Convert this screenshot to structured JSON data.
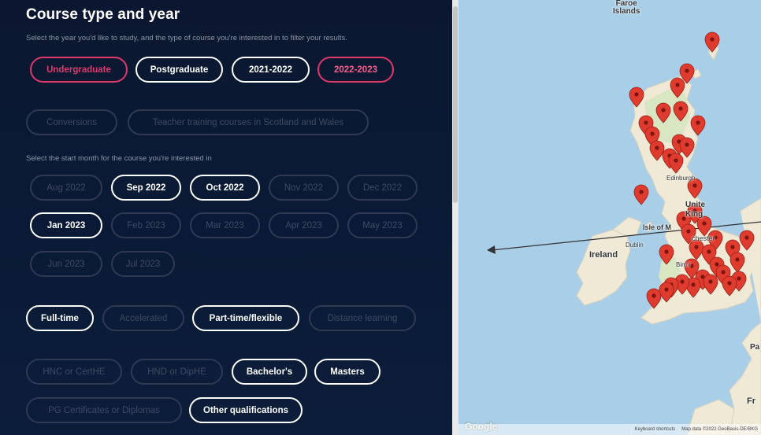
{
  "panel": {
    "title": "Course type and year",
    "subtitle_year": "Select the year you'd like to study, and the type of course you're interested in to filter your results.",
    "subtitle_month": "Select the start month for the course you're interested in",
    "course_type": [
      {
        "label": "Undergraduate",
        "state": "pink"
      },
      {
        "label": "Postgraduate",
        "state": "on"
      }
    ],
    "years": [
      {
        "label": "2021-2022",
        "state": "on"
      },
      {
        "label": "2022-2023",
        "state": "pink"
      }
    ],
    "extra_types": [
      {
        "label": "Conversions",
        "state": "dim"
      },
      {
        "label": "Teacher training courses in Scotland and Wales",
        "state": "dim"
      }
    ],
    "months_row1": [
      {
        "label": "Aug 2022",
        "state": "dim"
      },
      {
        "label": "Sep 2022",
        "state": "on"
      },
      {
        "label": "Oct 2022",
        "state": "on"
      },
      {
        "label": "Nov 2022",
        "state": "dim"
      },
      {
        "label": "Dec 2022",
        "state": "dim"
      }
    ],
    "months_row2": [
      {
        "label": "Jan 2023",
        "state": "on"
      },
      {
        "label": "Feb 2023",
        "state": "dim"
      },
      {
        "label": "Mar 2023",
        "state": "dim"
      },
      {
        "label": "Apr 2023",
        "state": "dim"
      },
      {
        "label": "May 2023",
        "state": "dim"
      }
    ],
    "months_row3": [
      {
        "label": "Jun 2023",
        "state": "dim"
      },
      {
        "label": "Jul 2023",
        "state": "dim"
      }
    ],
    "study_modes": [
      {
        "label": "Full-time",
        "state": "on"
      },
      {
        "label": "Accelerated",
        "state": "dim"
      },
      {
        "label": "Part-time/flexible",
        "state": "on"
      },
      {
        "label": "Distance learning",
        "state": "dim"
      }
    ],
    "qualifications_row1": [
      {
        "label": "HNC or CertHE",
        "state": "dim"
      },
      {
        "label": "HND or DipHE",
        "state": "dim"
      },
      {
        "label": "Bachelor's",
        "state": "on"
      },
      {
        "label": "Masters",
        "state": "on"
      }
    ],
    "qualifications_row2": [
      {
        "label": "PG Certificates or Diplomas",
        "state": "dim"
      },
      {
        "label": "Other qualifications",
        "state": "on"
      }
    ]
  },
  "map": {
    "labels": {
      "faroe": "Faroe\nIslands",
      "faroe_1": "Faroe",
      "faroe_2": "Islands",
      "ireland": "Ireland",
      "dublin": "Dublin",
      "isle_of_man": "Isle of M",
      "united_kingdom_1": "Unite",
      "united_kingdom_2": "King",
      "edinburgh": "Edinburgh",
      "manchester": "chester",
      "birmingham": "Birmi",
      "fr": "Fr",
      "pa": "Pa"
    },
    "google": "Google",
    "footer": {
      "shortcuts": "Keyboard shortcuts",
      "data": "Map data ©2022 GeoBasis-DE/BKG"
    },
    "colors": {
      "water": "#a9cfe8",
      "land": "#efe9d6",
      "land_green": "#d9e6c2",
      "pin": "#e03b2f"
    }
  },
  "colors": {
    "accent_pink": "#e0386b",
    "panel_bg": "#0b1730"
  }
}
